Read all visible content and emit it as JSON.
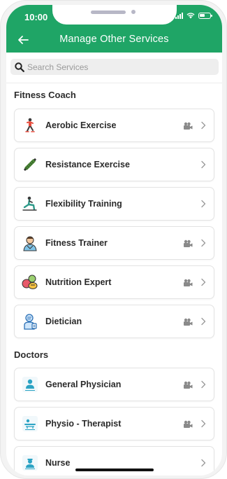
{
  "status_bar": {
    "time": "10:00"
  },
  "header": {
    "title": "Manage Other Services"
  },
  "search": {
    "placeholder": "Search Services",
    "value": ""
  },
  "sections": [
    {
      "title": "Fitness Coach",
      "items": [
        {
          "label": "Aerobic Exercise",
          "icon": "aerobic-icon",
          "video": true
        },
        {
          "label": "Resistance Exercise",
          "icon": "resistance-band-icon",
          "video": false
        },
        {
          "label": "Flexibility Training",
          "icon": "stretching-icon",
          "video": false
        },
        {
          "label": "Fitness Trainer",
          "icon": "trainer-icon",
          "video": true
        },
        {
          "label": "Nutrition Expert",
          "icon": "nutrition-icon",
          "video": true
        },
        {
          "label": "Dietician",
          "icon": "dietician-icon",
          "video": true
        }
      ]
    },
    {
      "title": "Doctors",
      "items": [
        {
          "label": "General Physician",
          "icon": "physician-icon",
          "video": true
        },
        {
          "label": "Physio - Therapist",
          "icon": "physiotherapist-icon",
          "video": true
        },
        {
          "label": "Nurse",
          "icon": "nurse-icon",
          "video": false
        }
      ]
    }
  ],
  "colors": {
    "accent": "#1fa566",
    "text": "#2a2a2a",
    "icon_gray": "#8a8a8a"
  }
}
